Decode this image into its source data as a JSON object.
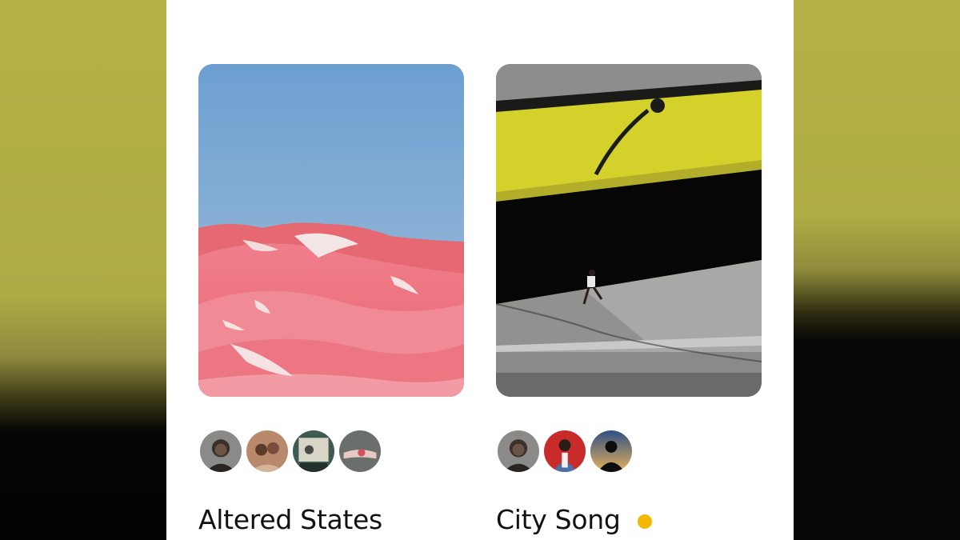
{
  "colors": {
    "card_background": "#ffffff",
    "title_text": "#111111",
    "new_activity_dot": "#f5b800"
  },
  "boards": [
    {
      "title": "Altered States",
      "cover": "pink-dunes-photo",
      "collaborators": [
        "collaborator-woman-portrait",
        "collaborator-friends-selfie",
        "collaborator-vintage-photo",
        "collaborator-hand-photo"
      ],
      "has_new_activity": false
    },
    {
      "title": "City Song",
      "cover": "runner-under-bridge-photo",
      "collaborators": [
        "collaborator-woman-portrait",
        "collaborator-red-background-portrait",
        "collaborator-silhouette-sunset"
      ],
      "has_new_activity": true
    }
  ]
}
